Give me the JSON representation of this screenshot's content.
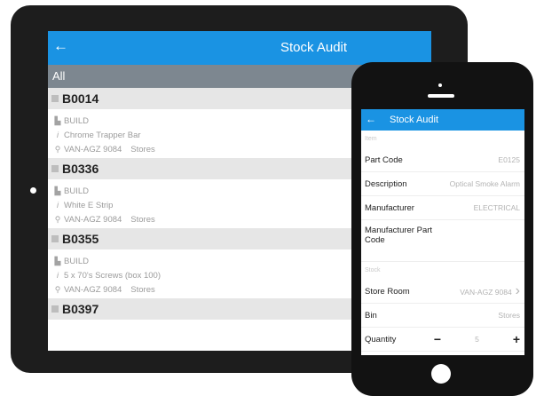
{
  "tablet": {
    "title": "Stock Audit",
    "back_icon": "arrow-left-icon",
    "filter_label": "All",
    "groups": [
      {
        "code": "B0014",
        "type": "BUILD",
        "description": "Chrome Trapper Bar",
        "location": "VAN-AGZ 9084",
        "bin": "Stores"
      },
      {
        "code": "B0336",
        "type": "BUILD",
        "description": "White E Strip",
        "location": "VAN-AGZ 9084",
        "bin": "Stores"
      },
      {
        "code": "B0355",
        "type": "BUILD",
        "description": "5 x 70's Screws (box 100)",
        "location": "VAN-AGZ 9084",
        "bin": "Stores"
      },
      {
        "code": "B0397"
      }
    ]
  },
  "phone": {
    "title": "Stock Audit",
    "section_item": "Item",
    "section_stock": "Stock",
    "fields": {
      "part_code": {
        "label": "Part Code",
        "value": "E0125"
      },
      "description": {
        "label": "Description",
        "value": "Optical Smoke Alarm"
      },
      "manufacturer": {
        "label": "Manufacturer",
        "value": "ELECTRICAL"
      },
      "manufacturer_part_code": {
        "label": "Manufacturer Part Code",
        "value": ""
      },
      "store_room": {
        "label": "Store Room",
        "value": "VAN-AGZ 9084"
      },
      "bin": {
        "label": "Bin",
        "value": "Stores"
      },
      "quantity": {
        "label": "Quantity",
        "value": "5",
        "minus": "−",
        "plus": "+"
      }
    }
  },
  "colors": {
    "accent": "#1a93e3",
    "filter_bar": "#7d8790",
    "device": "#1d1d1d"
  }
}
